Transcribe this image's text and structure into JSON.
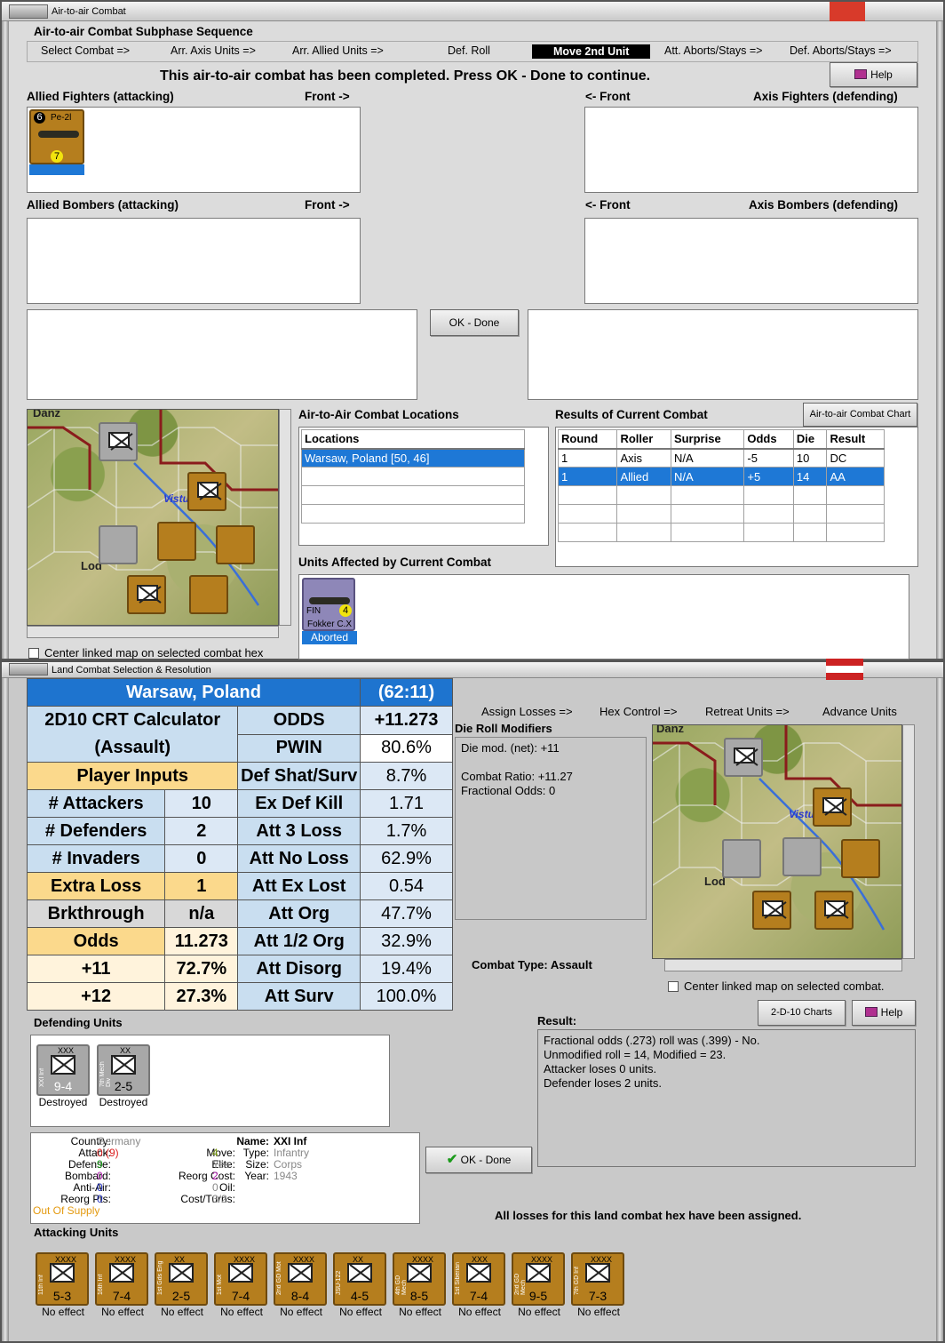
{
  "air_window": {
    "title": "Air-to-air Combat",
    "subphase_title": "Air-to-air Combat Subphase Sequence",
    "sequence": [
      "Select Combat =>",
      "Arr. Axis Units =>",
      "Arr. Allied Units =>",
      "Def. Roll",
      "Move 2nd Unit",
      "Att. Aborts/Stays =>",
      "Def. Aborts/Stays =>"
    ],
    "message": "This air-to-air combat has been completed.  Press OK - Done to continue.",
    "help_label": "Help",
    "allied_fighters": "Allied Fighters (attacking)",
    "front_right": "Front ->",
    "front_left": "<- Front",
    "axis_fighters": "Axis Fighters (defending)",
    "allied_bombers": "Allied Bombers (attacking)",
    "axis_bombers": "Axis Bombers (defending)",
    "ok_done": "OK - Done",
    "fighter_counter": {
      "name": "Pe-2l",
      "top": "6",
      "bottom": "7"
    },
    "locations_title": "Air-to-Air Combat Locations",
    "locations_header": "Locations",
    "locations": [
      "Warsaw, Poland [50, 46]"
    ],
    "results_title": "Results of Current Combat",
    "chart_button": "Air-to-air Combat Chart",
    "results_headers": [
      "Round",
      "Roller",
      "Surprise",
      "Odds",
      "Die",
      "Result"
    ],
    "results_rows": [
      [
        "1",
        "Axis",
        "N/A",
        "-5",
        "10",
        "DC"
      ],
      [
        "1",
        "Allied",
        "N/A",
        "+5",
        "14",
        "AA"
      ]
    ],
    "affected_title": "Units Affected by Current Combat",
    "affected_unit": {
      "name": "Fokker C.X",
      "country": "FIN",
      "value": "4",
      "status": "Aborted"
    },
    "center_map": "Center linked map on selected combat hex",
    "map_labels": {
      "vistula": "Vistu",
      "lodz": "Lod",
      "danzig": "Danz"
    }
  },
  "land_window": {
    "title": "Land Combat Selection & Resolution",
    "crt": {
      "location": "Warsaw, Poland",
      "code": "(62:11)",
      "calc_title_1": "2D10 CRT Calculator",
      "calc_title_2": "(Assault)",
      "player_inputs": "Player Inputs",
      "inputs": [
        [
          "# Attackers",
          "10"
        ],
        [
          "# Defenders",
          "2"
        ],
        [
          "# Invaders",
          "0"
        ],
        [
          "Extra Loss",
          "1"
        ],
        [
          "Brkthrough",
          "n/a"
        ],
        [
          "Odds",
          "11.273"
        ],
        [
          "+11",
          "72.7%"
        ],
        [
          "+12",
          "27.3%"
        ]
      ],
      "outputs": [
        [
          "ODDS",
          "+11.273"
        ],
        [
          "PWIN",
          "80.6%"
        ],
        [
          "Def Shat/Surv",
          "8.7%"
        ],
        [
          "Ex Def Kill",
          "1.71"
        ],
        [
          "Att 3 Loss",
          "1.7%"
        ],
        [
          "Att No Loss",
          "62.9%"
        ],
        [
          "Att Ex Lost",
          "0.54"
        ],
        [
          "Att Org",
          "47.7%"
        ],
        [
          "Att 1/2 Org",
          "32.9%"
        ],
        [
          "Att Disorg",
          "19.4%"
        ],
        [
          "Att Surv",
          "100.0%"
        ]
      ]
    },
    "sequence": [
      "Assign Losses =>",
      "Hex Control =>",
      "Retreat Units =>",
      "Advance Units"
    ],
    "die_roll_title": "Die Roll Modifiers",
    "die_mod": "Die mod. (net): +11",
    "combat_ratio": "Combat Ratio: +11.27",
    "fractional_odds": "Fractional Odds: 0",
    "combat_type": "Combat Type:  Assault",
    "center_map": "Center linked map on selected combat.",
    "charts_button": "2-D-10 Charts",
    "help_label": "Help",
    "defending_title": "Defending Units",
    "defenders": [
      {
        "name": "XXI Inf",
        "size": "XXX",
        "value": "9-4",
        "status": "Destroyed"
      },
      {
        "name": "7th Mech Div",
        "size": "XX",
        "value": "2-5",
        "status": "Destroyed"
      }
    ],
    "result_title": "Result:",
    "result_lines": [
      "Fractional odds (.273) roll was (.399)  - No.",
      "Unmodified roll = 14, Modified = 23.",
      "Attacker loses 0 units.",
      "Defender loses 2 units."
    ],
    "ok_done": "OK - Done",
    "unit_info": {
      "country_l": "Country:",
      "country": "Germany",
      "attack_l": "Attack:",
      "attack": "0 (9)",
      "defense_l": "Defense:",
      "defense": "9",
      "bombard_l": "Bombard:",
      "bombard": "0",
      "antiair_l": "Anti-Air:",
      "antiair": "0",
      "reorg_l": "Reorg Pts:",
      "reorg": "0",
      "supply": "Out Of Supply",
      "move_l": "Move:",
      "move": "4",
      "elite_l": "Elite:",
      "elite": "Yes",
      "reorgcost_l": "Reorg Cost:",
      "reorgcost": "2",
      "oil_l": "Oil:",
      "oil": "0",
      "costturns_l": "Cost/Turns:",
      "costturns": "3/2",
      "name_l": "Name:",
      "name": "XXI Inf",
      "type_l": "Type:",
      "type": "Infantry",
      "size_l": "Size:",
      "size": "Corps",
      "year_l": "Year:",
      "year": "1943"
    },
    "all_assigned": "All losses for this land combat hex have been assigned.",
    "attacking_title": "Attacking Units",
    "attackers": [
      {
        "name": "11th Inf",
        "size": "XXXX",
        "value": "5-3",
        "status": "No effect"
      },
      {
        "name": "16th Inf",
        "size": "XXXX",
        "value": "7-4",
        "status": "No effect"
      },
      {
        "name": "1st Gds Eng",
        "size": "XX",
        "value": "2-5",
        "status": "No effect"
      },
      {
        "name": "1st Mot",
        "size": "XXXX",
        "value": "7-4",
        "status": "No effect"
      },
      {
        "name": "2nd GD Mot",
        "size": "XXXX",
        "value": "8-4",
        "status": "No effect"
      },
      {
        "name": "JSU-122",
        "size": "XX",
        "value": "4-5",
        "status": "No effect"
      },
      {
        "name": "4th GD Mech",
        "size": "XXXX",
        "value": "8-5",
        "status": "No effect"
      },
      {
        "name": "1st Siberian",
        "size": "XXX",
        "value": "7-4",
        "status": "No effect"
      },
      {
        "name": "2nd GD Mech",
        "size": "XXXX",
        "value": "9-5",
        "status": "No effect"
      },
      {
        "name": "7th GD Inf",
        "size": "XXXX",
        "value": "7-3",
        "status": "No effect"
      }
    ]
  }
}
